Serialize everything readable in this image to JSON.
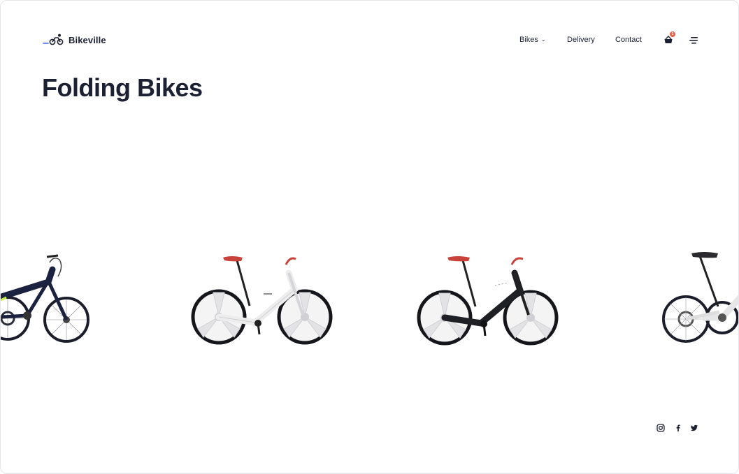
{
  "brand": {
    "name": "Bikeville"
  },
  "nav": {
    "items": [
      {
        "label": "Bikes",
        "has_dropdown": true,
        "icon": "chevron-down-icon"
      },
      {
        "label": "Delivery"
      },
      {
        "label": "Contact"
      }
    ],
    "cart": {
      "icon": "basket-icon",
      "badge_count": "2",
      "badge_color": "#e8604c"
    },
    "menu": {
      "icon": "menu-icon"
    }
  },
  "page": {
    "title": "Folding Bikes"
  },
  "carousel": {
    "bikes": [
      {
        "frame_color": "dark navy",
        "visible": "partial-left"
      },
      {
        "frame_color": "white"
      },
      {
        "frame_color": "black"
      },
      {
        "frame_color": "white",
        "visible": "partial-right"
      }
    ]
  },
  "social": {
    "icons": [
      "instagram-icon",
      "facebook-icon",
      "twitter-icon"
    ]
  },
  "colors": {
    "text": "#1c2033",
    "accent_blue": "#3b6cf6",
    "badge": "#e8604c",
    "saddle_red": "#c9423a"
  }
}
